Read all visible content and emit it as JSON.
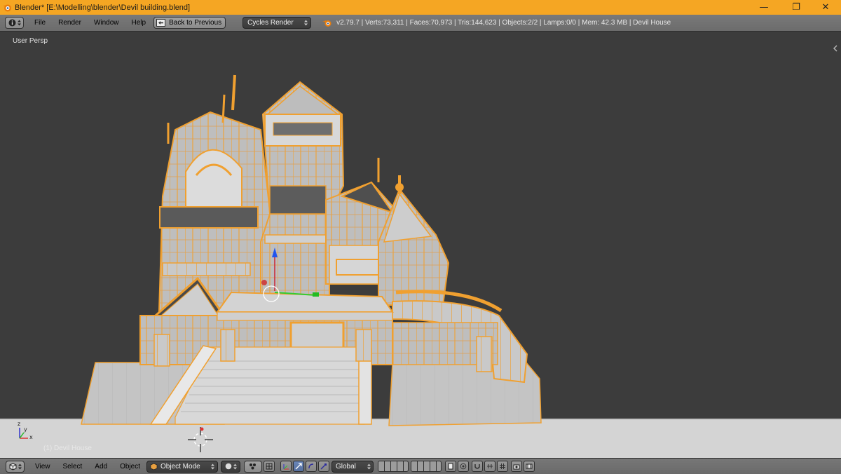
{
  "window": {
    "title": "Blender* [E:\\Modelling\\blender\\Devil building.blend]",
    "minimize_glyph": "—",
    "restore_glyph": "❐",
    "close_glyph": "✕"
  },
  "info_header": {
    "menus": [
      "File",
      "Render",
      "Window",
      "Help"
    ],
    "back_button": "Back to Previous",
    "render_engine": "Cycles Render",
    "stats": "v2.79.7 | Verts:73,311 | Faces:70,973 | Tris:144,623 | Objects:2/2 | Lamps:0/0 | Mem: 42.3 MB | Devil House"
  },
  "viewport": {
    "view_label": "User Persp",
    "object_label": "(1) Devil House",
    "axes": {
      "x": "x",
      "y": "y",
      "z": "z"
    }
  },
  "view3d_header": {
    "menus": [
      "View",
      "Select",
      "Add",
      "Object"
    ],
    "mode": "Object Mode",
    "orientation": "Global"
  },
  "colors": {
    "accent": "#f5a623",
    "viewport_bg": "#3c3c3c",
    "mesh_fill": "#c8c8c8",
    "mesh_edge": "#f0a030",
    "ground": "#d4d4d4"
  },
  "icons": {
    "app": "blender-logo-icon",
    "info_editor": "info-editor-icon",
    "view3d_editor": "view3d-editor-icon",
    "cursor": "3d-cursor-icon"
  }
}
